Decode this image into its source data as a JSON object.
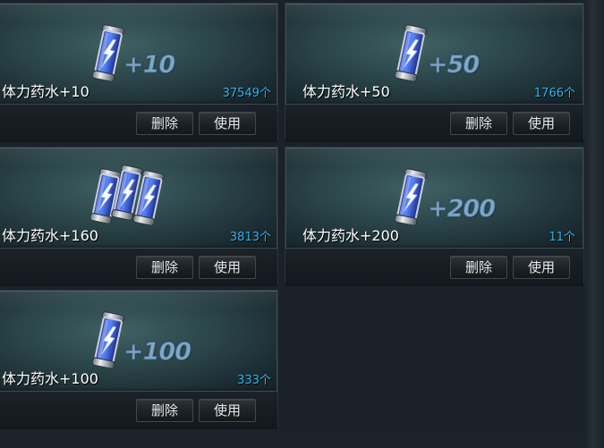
{
  "items": [
    {
      "name": "体力药水+10",
      "count": "37549个",
      "bonus": "+10",
      "delete_label": "删除",
      "use_label": "使用",
      "icon": "stamina-potion-icon"
    },
    {
      "name": "体力药水+50",
      "count": "1766个",
      "bonus": "+50",
      "delete_label": "删除",
      "use_label": "使用",
      "icon": "stamina-potion-icon"
    },
    {
      "name": "体力药水+160",
      "count": "3813个",
      "bonus": "",
      "delete_label": "删除",
      "use_label": "使用",
      "icon": "stamina-potion-stack-icon"
    },
    {
      "name": "体力药水+200",
      "count": "11个",
      "bonus": "+200",
      "delete_label": "删除",
      "use_label": "使用",
      "icon": "stamina-potion-icon"
    },
    {
      "name": "体力药水+100",
      "count": "333个",
      "bonus": "+100",
      "delete_label": "删除",
      "use_label": "使用",
      "icon": "stamina-potion-icon"
    }
  ],
  "colors": {
    "count": "#2fb7f0",
    "bonus": "#7fa8c4",
    "background": "#1a2128"
  }
}
